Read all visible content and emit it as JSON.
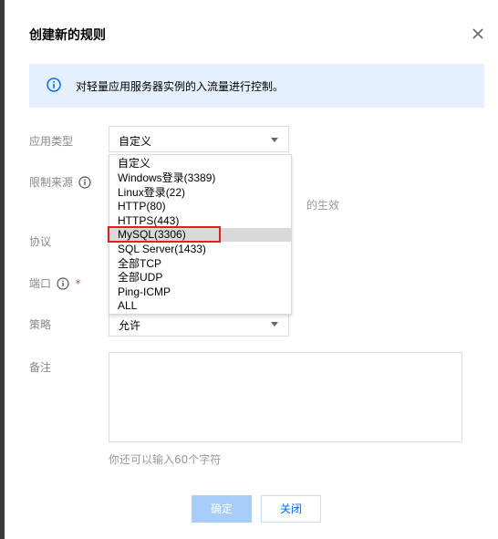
{
  "dialog": {
    "title": "创建新的规则",
    "close_icon": "close-icon"
  },
  "banner": {
    "icon": "info-icon",
    "text": "对轻量应用服务器实例的入流量进行控制。"
  },
  "form": {
    "app_type_label": "应用类型",
    "app_type_value": "自定义",
    "source_label": "限制来源",
    "source_partial_text": "的生效",
    "protocol_label": "协议",
    "port_label": "端口",
    "policy_label": "策略",
    "policy_value": "允许",
    "remark_label": "备注",
    "remark_hint": "你还可以输入60个字符"
  },
  "dropdown": {
    "options": [
      "自定义",
      "Windows登录(3389)",
      "Linux登录(22)",
      "HTTP(80)",
      "HTTPS(443)",
      "MySQL(3306)",
      "SQL Server(1433)",
      "全部TCP",
      "全部UDP",
      "Ping-ICMP",
      "ALL"
    ],
    "highlighted": "MySQL(3306)"
  },
  "buttons": {
    "confirm": "确定",
    "close": "关闭"
  },
  "colors": {
    "banner_bg": "#e5f0ff",
    "accent": "#006eff",
    "annotation_red": "#e02020"
  }
}
